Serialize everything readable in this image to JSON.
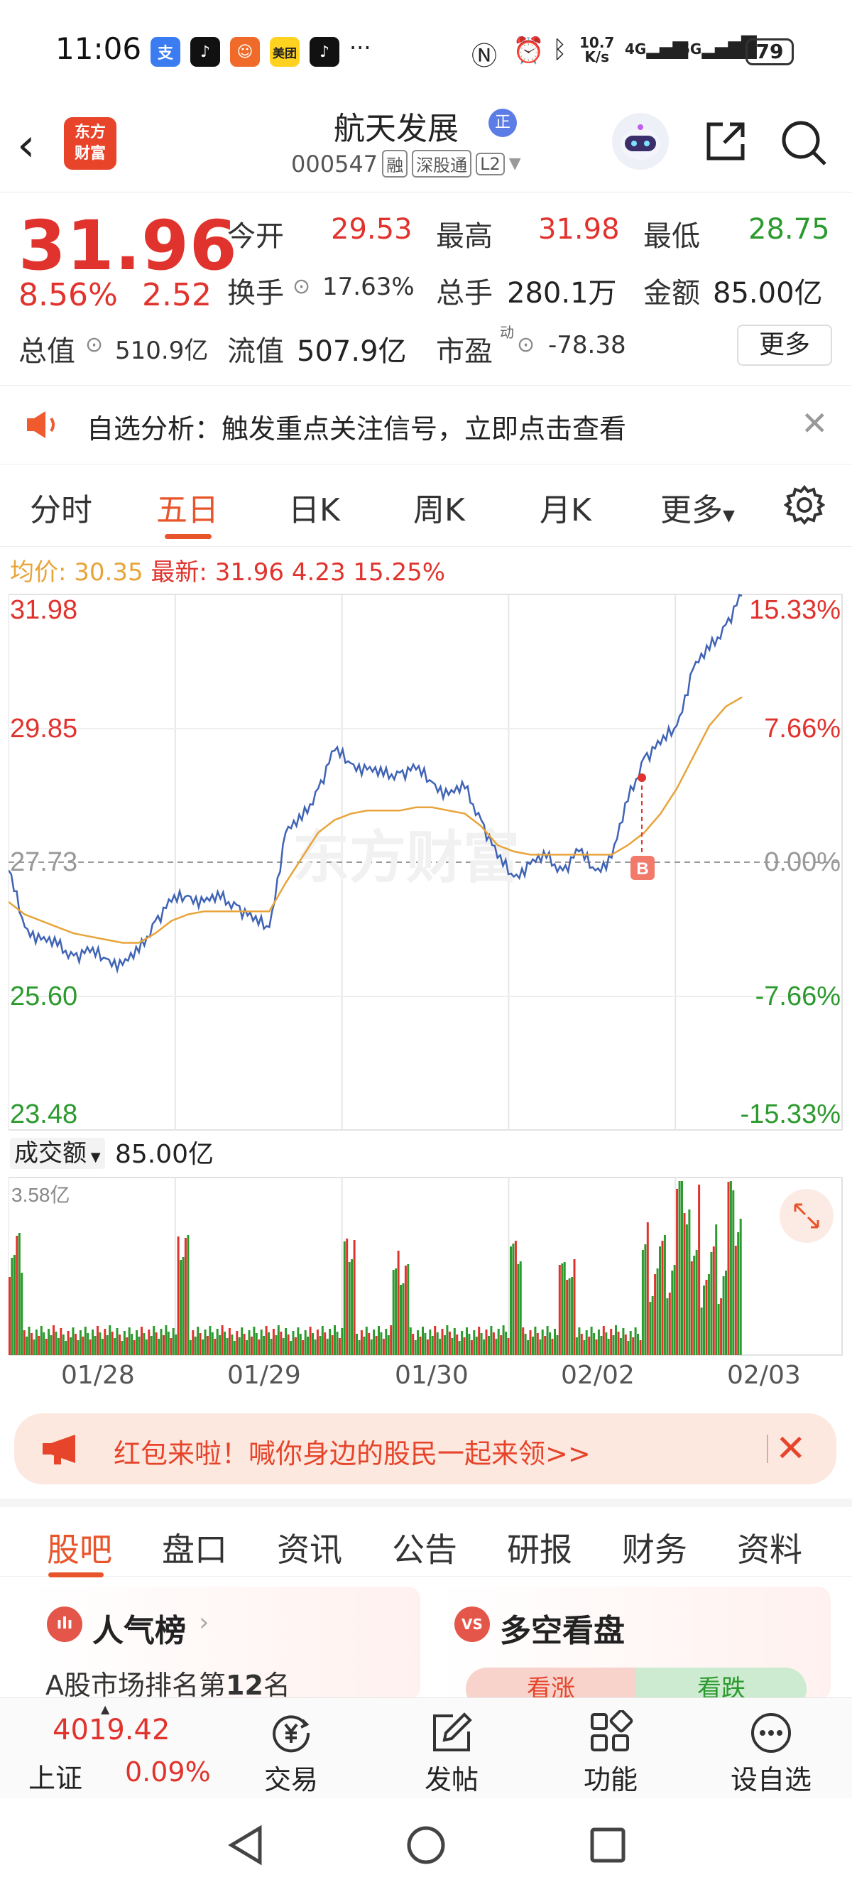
{
  "status_bar": {
    "time": "11:06",
    "apps": [
      "支",
      "♪",
      "☺",
      "美团",
      "♪"
    ],
    "more": "···",
    "net_speed_top": "10.7",
    "net_speed_bottom": "K/s",
    "sig1": "4G",
    "sig2": "5G",
    "battery": "79"
  },
  "header": {
    "logo_line1": "东方",
    "logo_line2": "财富",
    "stock_name": "航天发展",
    "badge": "正",
    "code": "000547",
    "tags": [
      "融",
      "深股通",
      "L2"
    ]
  },
  "quote": {
    "price": "31.96",
    "change_pct": "8.56%",
    "change": "2.52",
    "open_label": "今开",
    "open": "29.53",
    "high_label": "最高",
    "high": "31.98",
    "low_label": "最低",
    "low": "28.75",
    "turnover_label": "换手",
    "turnover": "17.63%",
    "volume_label": "总手",
    "volume": "280.1万",
    "amount_label": "金额",
    "amount": "85.00亿",
    "mcap_label": "总值",
    "mcap": "510.9亿",
    "float_label": "流值",
    "float": "507.9亿",
    "pe_label": "市盈",
    "pe_sup": "动",
    "pe": "-78.38",
    "more": "更多"
  },
  "banner": {
    "text": "自选分析：触发重点关注信号，立即点击查看"
  },
  "chart_tabs": [
    "分时",
    "五日",
    "日K",
    "周K",
    "月K",
    "更多"
  ],
  "active_tab": "五日",
  "avg_line": {
    "avg_label": "均价:",
    "avg": "30.35",
    "latest_label": "最新:",
    "latest": "31.96",
    "chg": "4.23",
    "pct": "15.25%"
  },
  "chart_data": {
    "type": "line",
    "title": "",
    "x": [
      "01/28",
      "01/29",
      "01/30",
      "02/02",
      "02/03"
    ],
    "y_left_ticks": [
      "31.98",
      "29.85",
      "27.73",
      "25.60",
      "23.48"
    ],
    "y_right_ticks": [
      "15.33%",
      "7.66%",
      "0.00%",
      "-7.66%",
      "-15.33%"
    ],
    "ylim": [
      23.48,
      31.98
    ],
    "baseline": 27.73,
    "series": [
      {
        "values": [
          27.6,
          26.7,
          26.5,
          26.4,
          26.25,
          26.3,
          26.2,
          26.1,
          26.3,
          26.8,
          27.1,
          27.2,
          27.1,
          27.15,
          27.05,
          26.8,
          26.7,
          28.2,
          28.4,
          28.9,
          29.5,
          29.3,
          29.2,
          29.1,
          29.15,
          29.2,
          29.0,
          28.8,
          28.9,
          28.4,
          27.8,
          27.5,
          27.7,
          27.8,
          27.6,
          27.9,
          27.6,
          27.8,
          28.7,
          29.4,
          29.6,
          29.9,
          30.8,
          31.1,
          31.5,
          31.96
        ]
      },
      {
        "values": [
          27.1,
          26.9,
          26.8,
          26.7,
          26.6,
          26.55,
          26.5,
          26.45,
          26.45,
          26.6,
          26.8,
          26.9,
          26.95,
          26.95,
          26.95,
          26.95,
          26.95,
          27.4,
          27.8,
          28.2,
          28.4,
          28.5,
          28.55,
          28.55,
          28.55,
          28.6,
          28.6,
          28.55,
          28.5,
          28.3,
          28.0,
          27.9,
          27.85,
          27.85,
          27.85,
          27.85,
          27.85,
          27.85,
          28.0,
          28.2,
          28.5,
          28.9,
          29.4,
          29.9,
          30.2,
          30.35
        ]
      }
    ],
    "volume_max": "3.58亿"
  },
  "volume": {
    "label": "成交额",
    "value": "85.00亿"
  },
  "red_packet": {
    "text": "红包来啦！喊你身边的股民一起来领>>"
  },
  "bottom_tabs": [
    "股吧",
    "盘口",
    "资讯",
    "公告",
    "研报",
    "财务",
    "资料"
  ],
  "active_bottom_tab": "股吧",
  "cards": {
    "popular_title": "人气榜",
    "popular_icon": "ılı",
    "popular_sub_prefix": "A股市场排名第",
    "popular_rank": "12",
    "popular_sub_suffix": "名",
    "bull_title": "多空看盘",
    "bull_icon": "VS",
    "bull_up": "看涨",
    "bull_down": "看跌"
  },
  "bottom_nav": {
    "index_value": "4019.42",
    "index_name": "上证",
    "index_pct": "0.09%",
    "items": [
      "交易",
      "发帖",
      "功能",
      "设自选"
    ]
  },
  "colors": {
    "up": "#e1332d",
    "down": "#2c9a2e",
    "accent": "#e8552b",
    "avg": "#e8a43a",
    "price_line": "#3f63b5"
  }
}
